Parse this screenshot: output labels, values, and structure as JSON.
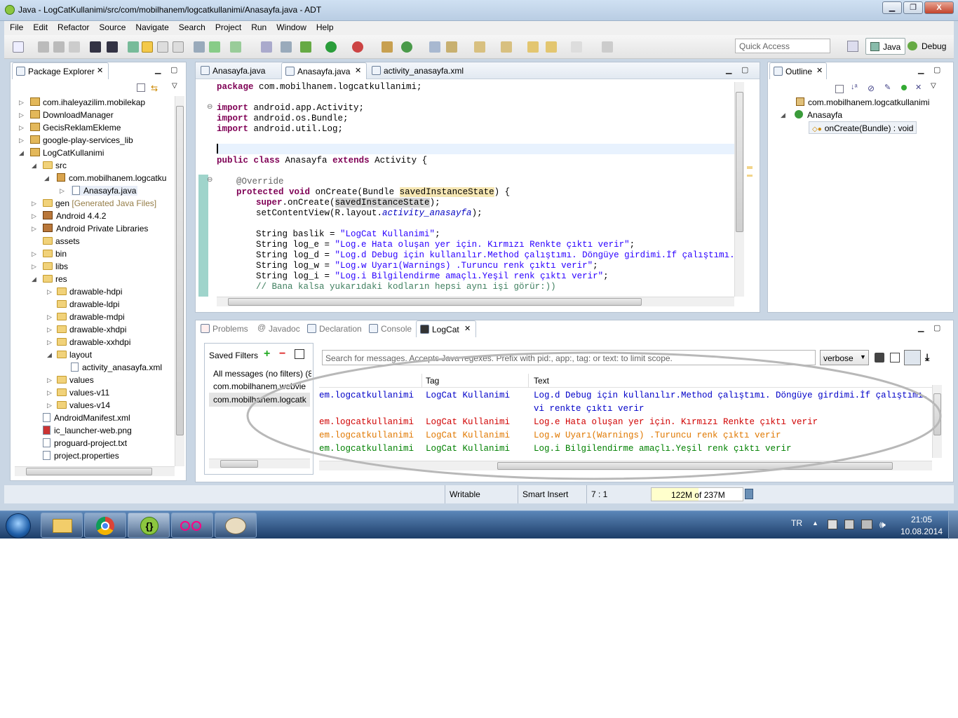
{
  "window": {
    "title": "Java - LogCatKullanimi/src/com/mobilhanem/logcatkullanimi/Anasayfa.java - ADT",
    "minimize": "▁",
    "restore": "❐",
    "close": "X"
  },
  "menu": [
    "File",
    "Edit",
    "Refactor",
    "Source",
    "Navigate",
    "Search",
    "Project",
    "Run",
    "Window",
    "Help"
  ],
  "toolbar": {
    "quick_access_placeholder": "Quick Access",
    "perspective_java": "Java",
    "perspective_debug": "Debug"
  },
  "package_explorer": {
    "tab_label": "Package Explorer",
    "items": [
      {
        "label": "com.ihaleyazilim.mobilekap"
      },
      {
        "label": "DownloadManager"
      },
      {
        "label": "GecisReklamEkleme"
      },
      {
        "label": "google-play-services_lib"
      },
      {
        "label": "LogCatKullanimi"
      },
      {
        "label": "src"
      },
      {
        "label": "com.mobilhanem.logcatku"
      },
      {
        "label": "Anasayfa.java"
      },
      {
        "label": "gen",
        "suffix": "[Generated Java Files]"
      },
      {
        "label": "Android 4.4.2"
      },
      {
        "label": "Android Private Libraries"
      },
      {
        "label": "assets"
      },
      {
        "label": "bin"
      },
      {
        "label": "libs"
      },
      {
        "label": "res"
      },
      {
        "label": "drawable-hdpi"
      },
      {
        "label": "drawable-ldpi"
      },
      {
        "label": "drawable-mdpi"
      },
      {
        "label": "drawable-xhdpi"
      },
      {
        "label": "drawable-xxhdpi"
      },
      {
        "label": "layout"
      },
      {
        "label": "activity_anasayfa.xml"
      },
      {
        "label": "values"
      },
      {
        "label": "values-v11"
      },
      {
        "label": "values-v14"
      },
      {
        "label": "AndroidManifest.xml"
      },
      {
        "label": "ic_launcher-web.png"
      },
      {
        "label": "proguard-project.txt"
      },
      {
        "label": "project.properties"
      }
    ]
  },
  "editor": {
    "tabs": [
      "Anasayfa.java",
      "Anasayfa.java",
      "activity_anasayfa.xml"
    ],
    "code": {
      "package_kw": "package",
      "package_name": " com.mobilhanem.logcatkullanimi;",
      "import_kw": "import",
      "import1": " android.app.Activity;",
      "import2": " android.os.Bundle;",
      "import3": " android.util.Log;",
      "public_kw": "public",
      "class_kw": "class",
      "class_name": " Anasayfa ",
      "extends_kw": "extends",
      "class_tail": " Activity {",
      "override": "@Override",
      "protected_kw": "protected",
      "void_kw": "void",
      "method_sig": " onCreate(Bundle ",
      "param": "savedInstanceState",
      "method_tail": ") {",
      "super_kw": "super",
      "super_call": ".onCreate(",
      "super_tail": ");",
      "setcontent": "setContentView(R.layout.",
      "layout_ref": "activity_anasayfa",
      "setcontent_tail": ");",
      "var1": "String baslik = ",
      "str1": "\"LogCat Kullanimi\"",
      "var2": "String log_e = ",
      "str2": "\"Log.e Hata oluşan yer için. Kırmızı Renkte çıktı verir\"",
      "var3": "String log_d = ",
      "str3": "\"Log.d Debug için kullanılır.Method çalıştımı. Döngüye girdimi.İf çalıştımı. Mavi r",
      "var4": "String log_w = ",
      "str4": "\"Log.w Uyarı(Warnings) .Turuncu renk çıktı verir\"",
      "var5": "String log_i = ",
      "str5": "\"Log.i Bilgilendirme amaçlı.Yeşil renk çıktı verir\"",
      "semicolon": ";",
      "comment": "// Bana kalsa yukarıdaki kodların hepsi aynı işi görür:))"
    }
  },
  "outline": {
    "tab_label": "Outline",
    "items": [
      "com.mobilhanem.logcatkullanimi",
      "Anasayfa",
      "onCreate(Bundle) : void"
    ]
  },
  "bottom": {
    "tabs": [
      "Problems",
      "Javadoc",
      "Declaration",
      "Console",
      "LogCat"
    ],
    "saved_filters_label": "Saved Filters",
    "filters": [
      "All messages (no filters) (8",
      "com.mobilhanem.webvie",
      "com.mobilhanem.logcatk"
    ],
    "search_placeholder": "Search for messages. Accepts Java regexes. Prefix with pid:, app:, tag: or text: to limit scope.",
    "level": "verbose",
    "columns": {
      "tag": "Tag",
      "text": "Text"
    },
    "rows": [
      {
        "app": "em.logcatkullanimi",
        "tag": "LogCat Kullanimi",
        "text": "Log.d Debug için kullanılır.Method çalıştımı. Döngüye girdimi.İf çalıştımı. Ma",
        "cont": "vi renkte çıktı verir",
        "color": "#0000c8"
      },
      {
        "app": "em.logcatkullanimi",
        "tag": "LogCat Kullanimi",
        "text": "Log.e Hata oluşan yer için. Kırmızı Renkte çıktı verir",
        "color": "#d00000"
      },
      {
        "app": "em.logcatkullanimi",
        "tag": "LogCat Kullanimi",
        "text": "Log.w Uyarı(Warnings) .Turuncu renk çıktı verir",
        "color": "#e07800"
      },
      {
        "app": "em.logcatkullanimi",
        "tag": "LogCat Kullanimi",
        "text": "Log.i Bilgilendirme amaçlı.Yeşil renk çıktı verir",
        "color": "#008000"
      }
    ]
  },
  "statusbar": {
    "writable": "Writable",
    "insert_mode": "Smart Insert",
    "position": "7 : 1",
    "heap": "122M of 237M",
    "heap_fraction": 0.515
  },
  "taskbar": {
    "language": "TR",
    "time": "21:05",
    "date": "10.08.2014",
    "start_icon": "windows-orb-icon",
    "apps": [
      "file-explorer-icon",
      "chrome-icon",
      "adt-icon",
      "flickr-icon",
      "paint-icon"
    ]
  },
  "colors": {
    "accent": "#2f5f98",
    "string": "#2a00ff",
    "keyword": "#7f0055",
    "comment": "#3f7f5f"
  }
}
